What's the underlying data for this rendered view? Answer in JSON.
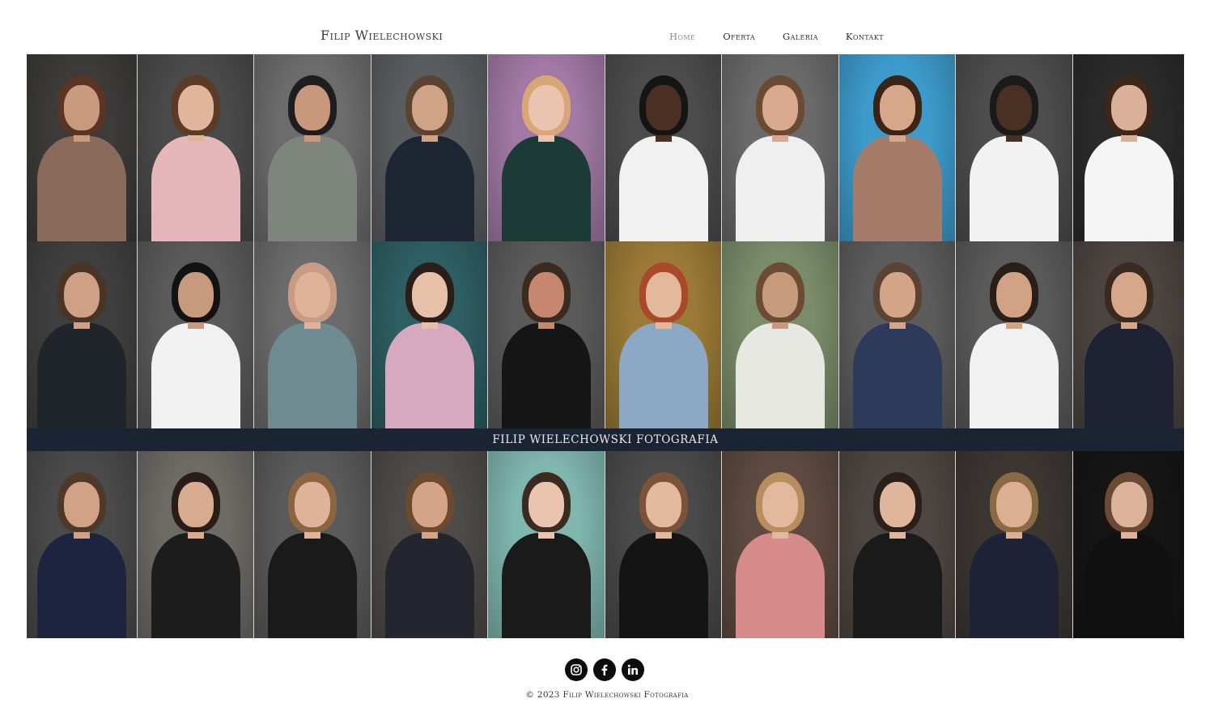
{
  "header": {
    "logo": "Filip Wielechowski",
    "nav": [
      {
        "label": "Home",
        "active": true
      },
      {
        "label": "Oferta",
        "active": false
      },
      {
        "label": "Galeria",
        "active": false
      },
      {
        "label": "Kontakt",
        "active": false
      }
    ]
  },
  "gallery": {
    "banner": "FILIP WIELECHOWSKI FOTOGRAFIA",
    "rows": [
      [
        {
          "bg": "#3c3b3a",
          "skin": "#c99a7e",
          "hair": "#5a3424",
          "outfit": "#8a6a5a"
        },
        {
          "bg": "#4a4a4a",
          "skin": "#e0b59c",
          "hair": "#5b3a26",
          "outfit": "#e5b7ba"
        },
        {
          "bg": "#6c6c6c",
          "skin": "#c8977c",
          "hair": "#1e1e1e",
          "outfit": "#7e857c"
        },
        {
          "bg": "#5a5d60",
          "skin": "#d1a386",
          "hair": "#5a4331",
          "outfit": "#1e2533"
        },
        {
          "bg": "#a179a4",
          "skin": "#ebc4b0",
          "hair": "#d9a677",
          "outfit": "#1c3a36"
        },
        {
          "bg": "#4c4c4c",
          "skin": "#4b2f22",
          "hair": "#151515",
          "outfit": "#f1f1f1"
        },
        {
          "bg": "#6a6a6a",
          "skin": "#d8a98e",
          "hair": "#6a4a33",
          "outfit": "#efefef"
        },
        {
          "bg": "#3d9bcc",
          "skin": "#d6a789",
          "hair": "#3a2416",
          "outfit": "#a57c6a"
        },
        {
          "bg": "#4d4d4d",
          "skin": "#4a2f23",
          "hair": "#1a1a1a",
          "outfit": "#f2f2f2"
        },
        {
          "bg": "#2a2a2a",
          "skin": "#dbb09a",
          "hair": "#3b281b",
          "outfit": "#f5f5f5"
        }
      ],
      [
        {
          "bg": "#3f3f3f",
          "skin": "#cfa085",
          "hair": "#4a3525",
          "outfit": "#20242b"
        },
        {
          "bg": "#5a5a5a",
          "skin": "#c79a7e",
          "hair": "#121212",
          "outfit": "#f1f1f1"
        },
        {
          "bg": "#6b6b6b",
          "skin": "#dfb29a",
          "hair": "#c79b84",
          "outfit": "#6f8b92"
        },
        {
          "bg": "#2d5e63",
          "skin": "#e7c0aa",
          "hair": "#2b1e18",
          "outfit": "#d6a9bf"
        },
        {
          "bg": "#5a5a5a",
          "skin": "#c7876e",
          "hair": "#3a2a20",
          "outfit": "#151515"
        },
        {
          "bg": "#9a7a36",
          "skin": "#e3b89b",
          "hair": "#a8492a",
          "outfit": "#8ca8c4"
        },
        {
          "bg": "#7a8c6a",
          "skin": "#c59b7c",
          "hair": "#6b4b33",
          "outfit": "#e8e8e2"
        },
        {
          "bg": "#5c5c5c",
          "skin": "#d4a588",
          "hair": "#5a4332",
          "outfit": "#2e3a5c"
        },
        {
          "bg": "#5a5a5a",
          "skin": "#d2a285",
          "hair": "#2a1e18",
          "outfit": "#f1f1f1"
        },
        {
          "bg": "#4c4441",
          "skin": "#d7a78b",
          "hair": "#3a2a1e",
          "outfit": "#1e2233"
        }
      ],
      [
        {
          "bg": "#4a4a4a",
          "skin": "#d2a286",
          "hair": "#4e3828",
          "outfit": "#1d2440"
        },
        {
          "bg": "#6e6a66",
          "skin": "#d9ac92",
          "hair": "#2a1c16",
          "outfit": "#1d1d1d"
        },
        {
          "bg": "#5a5a5a",
          "skin": "#e0b49a",
          "hair": "#8c6440",
          "outfit": "#1a1a1a"
        },
        {
          "bg": "#4e4a48",
          "skin": "#d5a488",
          "hair": "#6b4a30",
          "outfit": "#23262e"
        },
        {
          "bg": "#7fb6ae",
          "skin": "#eac4ae",
          "hair": "#3a2a20",
          "outfit": "#1a1a1a"
        },
        {
          "bg": "#4a4a4a",
          "skin": "#e3b9a0",
          "hair": "#7a5338",
          "outfit": "#141414"
        },
        {
          "bg": "#5e4a40",
          "skin": "#e2b89e",
          "hair": "#b88e5e",
          "outfit": "#d48b8a"
        },
        {
          "bg": "#4e4642",
          "skin": "#dfb59c",
          "hair": "#2c1f19",
          "outfit": "#1a1a1a"
        },
        {
          "bg": "#3c3633",
          "skin": "#dcae92",
          "hair": "#8a6a42",
          "outfit": "#1d2236"
        },
        {
          "bg": "#151515",
          "skin": "#ddb49b",
          "hair": "#6a4a34",
          "outfit": "#101010"
        }
      ]
    ]
  },
  "footer": {
    "social": [
      {
        "name": "instagram-icon"
      },
      {
        "name": "facebook-icon"
      },
      {
        "name": "linkedin-icon"
      }
    ],
    "copyright": "© 2023 Filip Wielechowski Fotografia"
  }
}
